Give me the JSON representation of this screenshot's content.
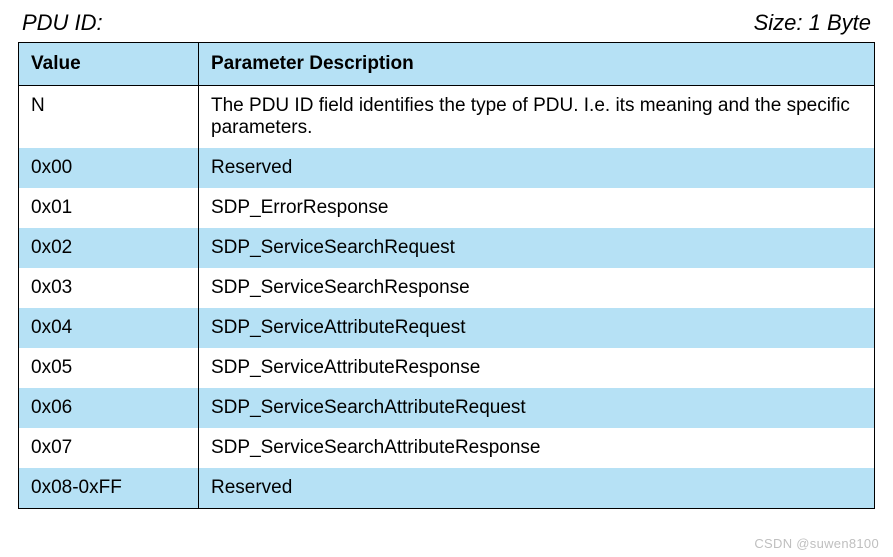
{
  "header": {
    "title": "PDU ID:",
    "size": "Size: 1 Byte"
  },
  "table": {
    "columns": {
      "value": "Value",
      "desc": "Parameter Description"
    },
    "rows": [
      {
        "value": "N",
        "desc": "The PDU ID field identifies the type of PDU. I.e. its meaning and the specific parameters."
      },
      {
        "value": "0x00",
        "desc": "Reserved"
      },
      {
        "value": "0x01",
        "desc": "SDP_ErrorResponse"
      },
      {
        "value": "0x02",
        "desc": "SDP_ServiceSearchRequest"
      },
      {
        "value": "0x03",
        "desc": "SDP_ServiceSearchResponse"
      },
      {
        "value": "0x04",
        "desc": "SDP_ServiceAttributeRequest"
      },
      {
        "value": "0x05",
        "desc": "SDP_ServiceAttributeResponse"
      },
      {
        "value": "0x06",
        "desc": "SDP_ServiceSearchAttributeRequest"
      },
      {
        "value": "0x07",
        "desc": "SDP_ServiceSearchAttributeResponse"
      },
      {
        "value": "0x08-0xFF",
        "desc": "Reserved"
      }
    ]
  },
  "watermark": "CSDN @suwen8100"
}
